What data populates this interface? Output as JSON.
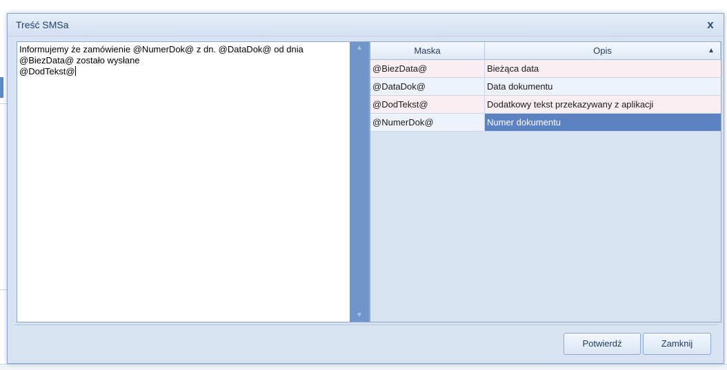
{
  "dialog": {
    "title": "Treść SMSa",
    "close_glyph": "x"
  },
  "message": {
    "text": "Informujemy że zamówienie @NumerDok@ z dn. @DataDok@ od dnia @BiezData@ zostało wysłane\n@DodTekst@"
  },
  "scrollbar": {
    "up_glyph": "▲",
    "down_glyph": "▼"
  },
  "grid": {
    "columns": [
      "Maska",
      "Opis"
    ],
    "sort_glyph": "▲",
    "rows": [
      {
        "maska": "@BiezData@",
        "opis": "Bieżąca data"
      },
      {
        "maska": "@DataDok@",
        "opis": "Data dokumentu"
      },
      {
        "maska": "@DodTekst@",
        "opis": "Dodatkowy tekst przekazywany z aplikacji"
      },
      {
        "maska": "@NumerDok@",
        "opis": "Numer dokumentu"
      }
    ],
    "selected_row": 3
  },
  "buttons": {
    "confirm": "Potwierdź",
    "close": "Zamknij"
  },
  "colors": {
    "selection": "#5d82c2",
    "scrollbar": "#6f95c9",
    "dialog_bg": "#d7e3f3"
  }
}
